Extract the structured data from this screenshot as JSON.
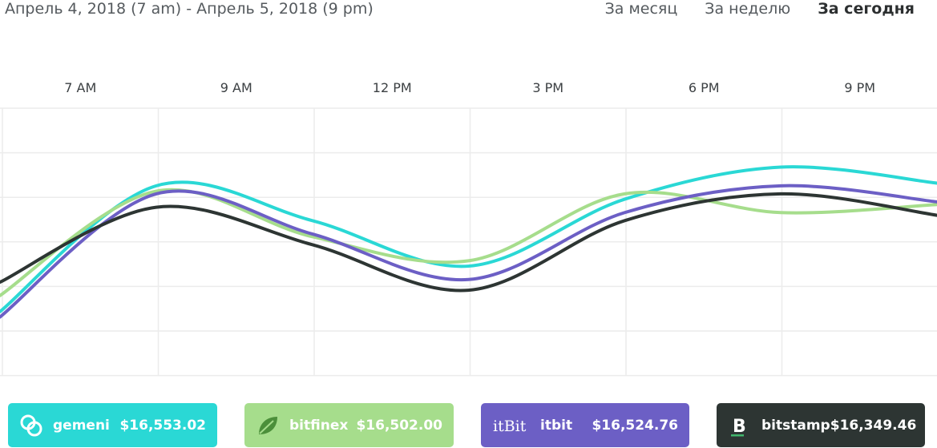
{
  "header": {
    "date_range": "Апрель 4, 2018 (7 am) - Апрель 5, 2018 (9 pm)",
    "periods": [
      {
        "label": "За месяц",
        "active": false
      },
      {
        "label": "За неделю",
        "active": false
      },
      {
        "label": "За сегодня",
        "active": true
      }
    ]
  },
  "chart_data": {
    "type": "line",
    "x_tick_labels": [
      "7 AM",
      "9 AM",
      "12 PM",
      "3 PM",
      "6 PM",
      "9 PM"
    ],
    "grid": true,
    "y_axis_labels_visible": false,
    "series": [
      {
        "name": "gemeni",
        "color": "#2ad8d5",
        "values": [
          -2.1,
          2.6,
          1.3,
          -0.4,
          2.1,
          3.3,
          2.7
        ]
      },
      {
        "name": "bitfinex",
        "color": "#a6dd8c",
        "values": [
          -1.5,
          2.4,
          0.7,
          -0.2,
          2.3,
          1.6,
          1.9
        ]
      },
      {
        "name": "itbit",
        "color": "#6c5fc5",
        "values": [
          -2.3,
          2.3,
          0.8,
          -0.9,
          1.6,
          2.6,
          2.0
        ]
      },
      {
        "name": "bitstamp",
        "color": "#2d3533",
        "values": [
          -1.0,
          1.8,
          0.4,
          -1.3,
          1.3,
          2.3,
          1.5
        ]
      }
    ]
  },
  "cards": [
    {
      "name": "gemeni",
      "price": "$16,553.02",
      "color": "#2ad8d5",
      "icon": "gemini-logo-icon"
    },
    {
      "name": "bitfinex",
      "price": "$16,502.00",
      "color": "#a6dd8c",
      "icon": "leaf-icon"
    },
    {
      "name": "itbit",
      "price": "$16,524.76",
      "color": "#6c5fc5",
      "icon": "itbit-logo-icon"
    },
    {
      "name": "bitstamp",
      "price": "$16,349.46",
      "color": "#2d3533",
      "icon": "bitstamp-b-icon"
    }
  ]
}
